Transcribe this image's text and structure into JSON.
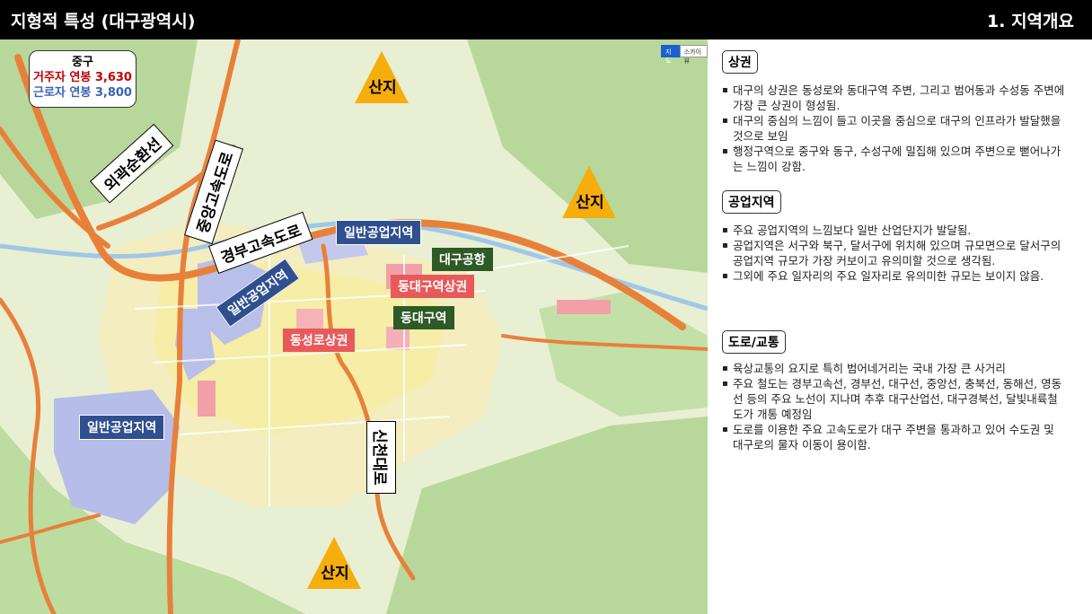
{
  "header": {
    "title": "지형적 특성 (대구광역시)",
    "section": "1. 지역개요"
  },
  "map": {
    "infobox": {
      "district": "중구",
      "resident": "거주자 연봉 3,630",
      "worker": "근로자 연봉 3,800"
    },
    "controls": [
      "지도",
      "스카이뷰"
    ],
    "mountains": [
      "산지",
      "산지",
      "산지"
    ],
    "roads": {
      "outer_ring": "외곽순환선",
      "jungang": "중앙고속도로",
      "gyeongbu": "경부고속도로",
      "sincheon": "신천대로"
    },
    "zones": {
      "industrial_1": "일반공업지역",
      "industrial_2": "일반공업지역",
      "industrial_3": "일반공업지역",
      "airport": "대구공항",
      "east_station_commercial": "동대구역상권",
      "east_station": "동대구역",
      "dongseongro": "동성로상권"
    },
    "colors": {
      "road": "#e8803a",
      "mountain": "#f5ae0b",
      "industrial": "#2f4f8f",
      "commercial": "#e85a5a",
      "landmark": "#2e5a26"
    }
  },
  "sections": [
    {
      "title": "상권",
      "items": [
        "대구의 상권은 동성로와 동대구역 주변, 그리고 범어동과 수성동 주변에 가장 큰 상권이 형성됨.",
        "대구의 중심의 느낌이 들고 이곳을 중심으로 대구의 인프라가 발달했을 것으로 보임",
        "행정구역으로 중구와 동구, 수성구에 밀집해 있으며 주변으로 뻗어나가는 느낌이 강함."
      ]
    },
    {
      "title": "공업지역",
      "items": [
        "주요 공업지역의 느낌보다 일반 산업단지가 발달됨.",
        "공업지역은 서구와 북구, 달서구에 위치해 있으며 규모면으로 달서구의 공업지역 규모가 가장 커보이고 유의미할 것으로 생각됨.",
        "그외에 주요 일자리의 주요 일자리로 유의미한 규모는 보이지 않음."
      ]
    },
    {
      "title": "도로/교통",
      "items": [
        "육상교통의 요지로 특히 범어네거리는 국내 가장 큰 사거리",
        "주요 철도는 경부고속선, 경부선, 대구선, 중앙선, 충북선, 동해선, 영동선 등의 주요 노선이 지나며 추후 대구산업선, 대구경북선, 달빛내륙철도가 개통 예정임",
        "도로를 이용한 주요 고속도로가 대구 주변을 통과하고 있어 수도권 및 대구로의 물자 이동이 용이함."
      ]
    }
  ]
}
